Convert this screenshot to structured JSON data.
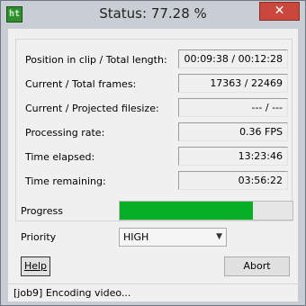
{
  "window": {
    "title": "Status: 77.28 %",
    "close_glyph": "✕"
  },
  "stats": [
    {
      "label": "Position in clip / Total length:",
      "value": "00:09:38 / 00:12:28"
    },
    {
      "label": "Current / Total frames:",
      "value": "17363 / 22469"
    },
    {
      "label": "Current / Projected filesize:",
      "value": "--- / ---"
    },
    {
      "label": "Processing rate:",
      "value": "0.36 FPS"
    },
    {
      "label": "Time elapsed:",
      "value": "13:23:46"
    },
    {
      "label": "Time remaining:",
      "value": "03:56:22"
    }
  ],
  "progress": {
    "label": "Progress",
    "fraction": 0.7728,
    "fill_color": "#06b025"
  },
  "priority": {
    "label": "Priority",
    "selected": "HIGH"
  },
  "buttons": {
    "help": "Help",
    "abort": "Abort"
  },
  "status_bar": {
    "text": "[job9]  Encoding video..."
  },
  "icons": {
    "app": "app-logo-icon",
    "close": "close-icon",
    "dropdown": "chevron-down-icon"
  }
}
